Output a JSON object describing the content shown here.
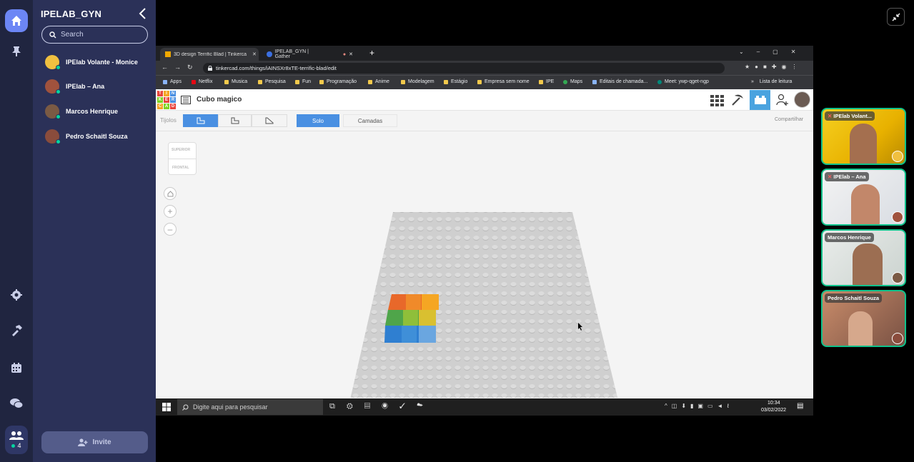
{
  "sidebar": {
    "title": "IPELAB_GYN",
    "search_placeholder": "Search",
    "members": [
      {
        "name": "IPElab Volante - Monice"
      },
      {
        "name": "IPElab – Ana"
      },
      {
        "name": "Marcos Henrique"
      },
      {
        "name": "Pedro Schaitl Souza"
      }
    ],
    "online_count": "4",
    "invite_label": "Invite"
  },
  "browser": {
    "tabs": [
      {
        "label": "3D design Terrific Blad | Tinkerca"
      },
      {
        "label": "IPELAB_GYN | Gather"
      }
    ],
    "url": "tinkercad.com/things/iAINSXr8xTE-terrific-blad/edit",
    "bookmarks": [
      "Apps",
      "Netflix",
      "Musica",
      "Pesquisa",
      "Fun",
      "Programação",
      "Anime",
      "Modelagem",
      "Estágio",
      "Empresa sem nome",
      "IPE",
      "Maps",
      "Editais de chamada...",
      "Meet: ywp-qget-ngp"
    ],
    "reading_list": "Lista de leitura"
  },
  "tinkercad": {
    "logo_letters": [
      "TIN",
      "KER",
      "CAD"
    ],
    "project_title": "Cubo magico",
    "bricks_label": "Tijolos",
    "solo_label": "Solo",
    "layers_label": "Camadas",
    "share_label": "Compartilhar",
    "viewcube_top": "SUPERIOR",
    "viewcube_front": "FRONTAL"
  },
  "taskbar": {
    "search_placeholder": "Digite aqui para pesquisar",
    "time": "10:34",
    "date": "03/02/2022"
  },
  "videos": [
    {
      "name": "IPElab Volant..."
    },
    {
      "name": "IPElab – Ana"
    },
    {
      "name": "Marcos Henrique"
    },
    {
      "name": "Pedro Schaitl Souza"
    }
  ]
}
